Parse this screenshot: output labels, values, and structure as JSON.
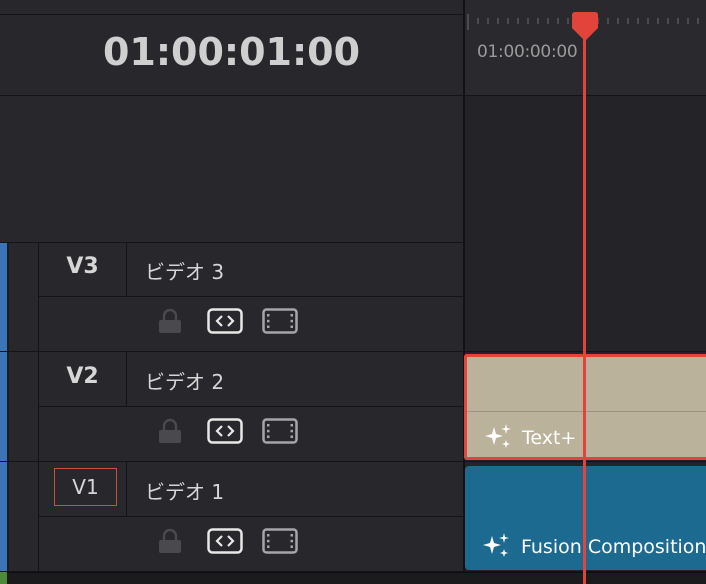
{
  "header": {
    "timecode": "01:00:01:00"
  },
  "ruler": {
    "start_timecode": "01:00:00:00"
  },
  "tracks": [
    {
      "id": "V3",
      "name": "ビデオ 3",
      "selected": false
    },
    {
      "id": "V2",
      "name": "ビデオ 2",
      "selected": false
    },
    {
      "id": "V1",
      "name": "ビデオ 1",
      "selected": true
    }
  ],
  "clips": {
    "text": {
      "label": "Text+",
      "color": "#bbb29b",
      "border": "#e2443b"
    },
    "fusion": {
      "label": "Fusion Composition",
      "color": "#1d6a91"
    }
  },
  "icons": {
    "lock": "lock-icon",
    "auto_select": "auto-select-icon",
    "track_toggle": "film-strip-icon"
  },
  "colors": {
    "playhead": "#e2443b",
    "video_track": "#3b74b7",
    "audio_track": "#4c8a3b"
  }
}
